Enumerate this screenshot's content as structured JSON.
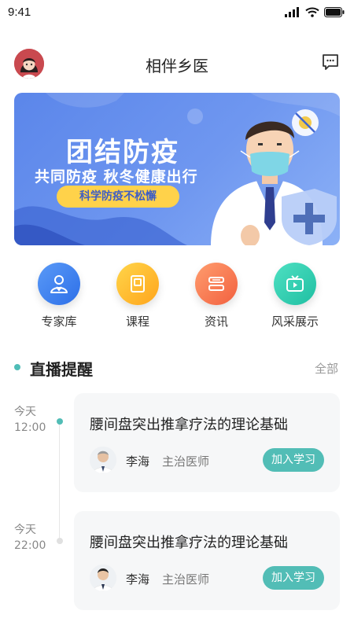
{
  "status_bar": {
    "time": "9:41"
  },
  "header": {
    "title": "相伴乡医"
  },
  "banner": {
    "title": "团结防疫",
    "subtitle": "共同防疫 秋冬健康出行",
    "pill": "科学防疫不松懈"
  },
  "categories": [
    {
      "label": "专家库",
      "icon": "expert-icon",
      "color": "#3b7cf0"
    },
    {
      "label": "课程",
      "icon": "course-book-icon",
      "color": "#ffb324"
    },
    {
      "label": "资讯",
      "icon": "news-icon",
      "color": "#f77b54"
    },
    {
      "label": "风采展示",
      "icon": "tv-icon",
      "color": "#2ecfb1"
    }
  ],
  "live_section": {
    "title": "直播提醒",
    "more": "全部"
  },
  "live_items": [
    {
      "day": "今天",
      "time": "12:00",
      "title": "腰间盘突出推拿疗法的理论基础",
      "doctor": "李海",
      "role": "主治医师",
      "action": "加入学习"
    },
    {
      "day": "今天",
      "time": "22:00",
      "title": "腰间盘突出推拿疗法的理论基础",
      "doctor": "李海",
      "role": "主治医师",
      "action": "加入学习"
    }
  ],
  "colors": {
    "accent": "#52bdb6",
    "banner": "#6f97f0"
  }
}
